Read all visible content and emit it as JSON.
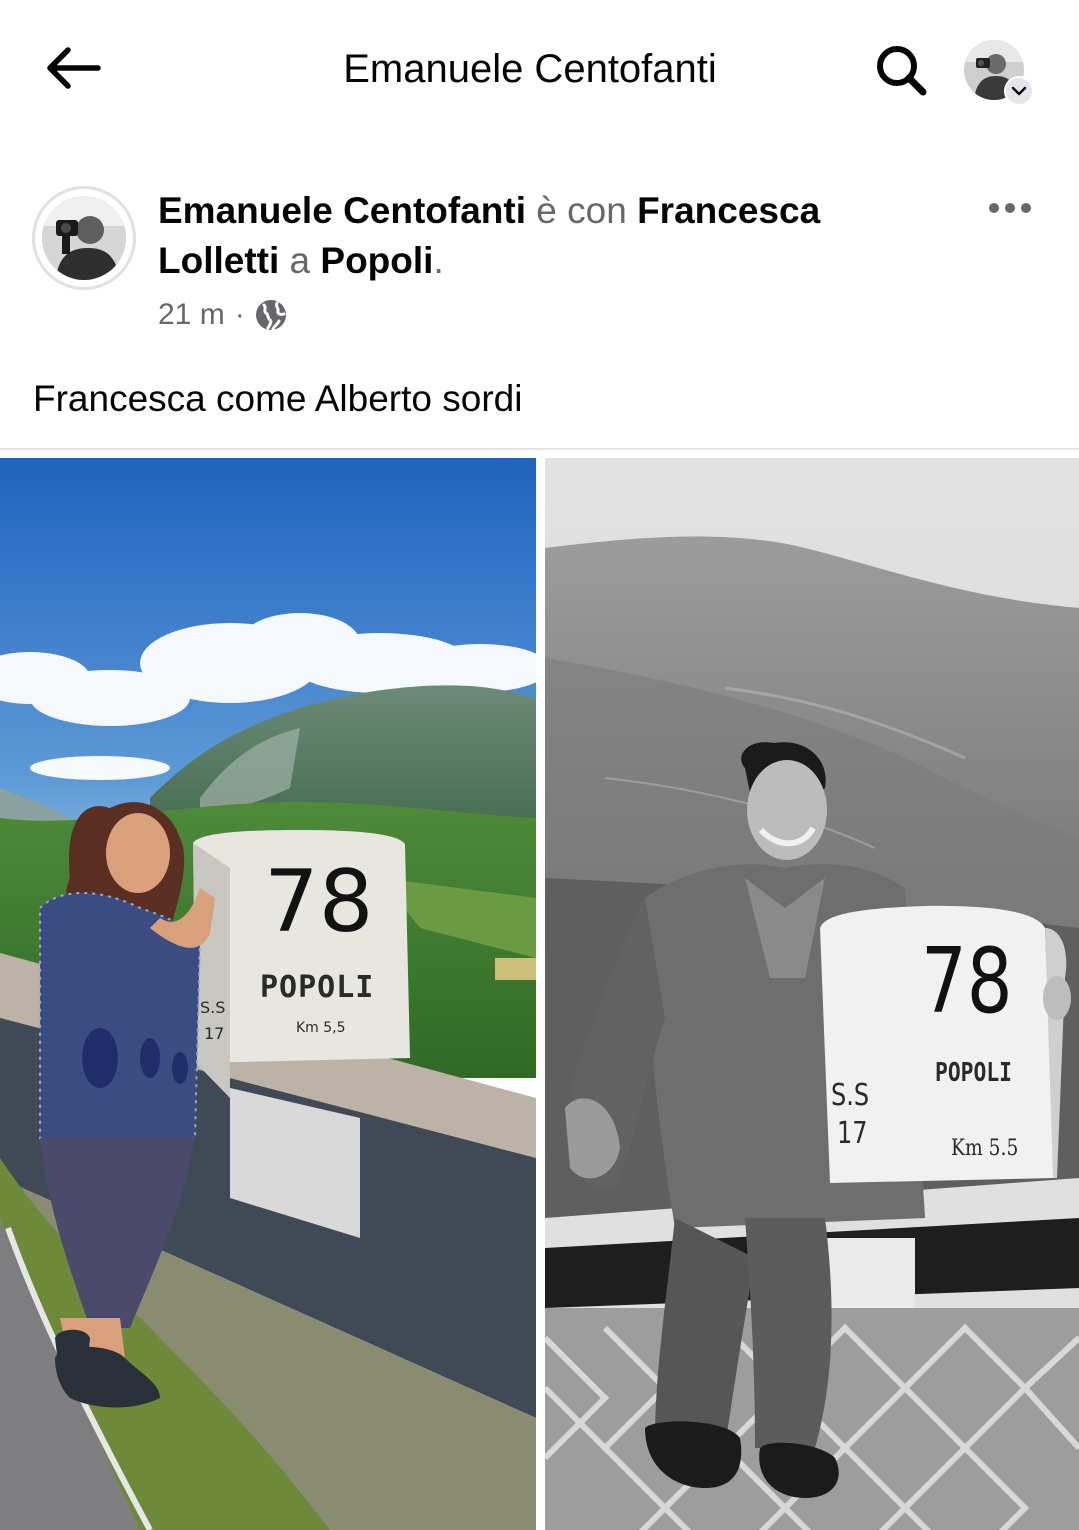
{
  "topbar": {
    "title": "Emanuele Centofanti",
    "back_icon": "arrow-left-icon",
    "search_icon": "search-icon",
    "account_icon": "avatar-with-chevron"
  },
  "post": {
    "author": "Emanuele Centofanti",
    "with_word": "è con",
    "tagged": "Francesca Lolletti",
    "at_word": "a",
    "place": "Popoli",
    "period": ".",
    "time": "21 m",
    "separator": "·",
    "privacy_icon": "globe-icon",
    "more_icon": "more-horizontal-icon",
    "caption": "Francesca come Alberto sordi"
  },
  "photos": {
    "left": {
      "milestone_number": "78",
      "milestone_town": "POPOLI",
      "milestone_road_1": "S.S",
      "milestone_road_2": "17",
      "milestone_km": "Km 5,5"
    },
    "right": {
      "milestone_number": "78",
      "milestone_town": "POPOLI",
      "milestone_road_1": "S.S",
      "milestone_road_2": "17",
      "milestone_km": "Km 5.5"
    }
  },
  "colors": {
    "text_primary": "#050505",
    "text_secondary": "#65676b",
    "divider": "#e4e6eb"
  }
}
